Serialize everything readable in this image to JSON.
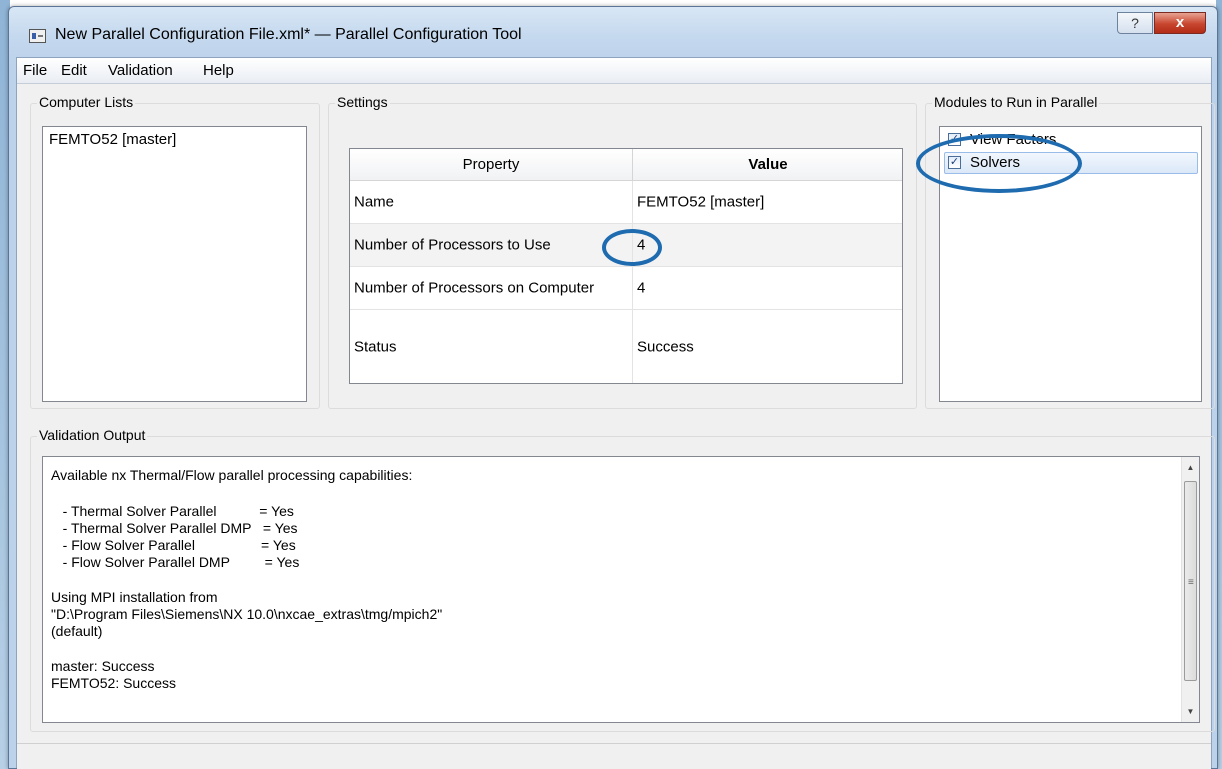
{
  "window": {
    "title": "New Parallel Configuration File.xml* — Parallel Configuration Tool",
    "help_glyph": "?",
    "close_glyph": "x"
  },
  "menu": [
    "File",
    "Edit",
    "Validation",
    "Help"
  ],
  "computer_lists": {
    "label": "Computer Lists",
    "items": [
      "FEMTO52 [master]"
    ]
  },
  "settings": {
    "label": "Settings",
    "columns": [
      "Property",
      "Value"
    ],
    "rows": [
      {
        "property": "Name",
        "value": "FEMTO52 [master]"
      },
      {
        "property": "Number of Processors to Use",
        "value": "4"
      },
      {
        "property": "Number of Processors on Computer",
        "value": "4"
      },
      {
        "property": "Status",
        "value": "Success"
      }
    ]
  },
  "modules": {
    "label": "Modules to Run in Parallel",
    "items": [
      {
        "label": "View Factors",
        "checked": true
      },
      {
        "label": "Solvers",
        "checked": true
      }
    ]
  },
  "validation": {
    "label": "Validation Output",
    "lines": [
      "Available nx Thermal/Flow parallel processing capabilities:",
      "",
      "   - Thermal Solver Parallel           = Yes",
      "   - Thermal Solver Parallel DMP   = Yes",
      "   - Flow Solver Parallel                 = Yes",
      "   - Flow Solver Parallel DMP         = Yes",
      "",
      "Using MPI installation from",
      "\"D:\\Program Files\\Siemens\\NX 10.0\\nxcae_extras\\tmg/mpich2\"",
      "(default)",
      "",
      "master: Success",
      "FEMTO52: Success"
    ]
  },
  "colors": {
    "annotation": "#1e6bb0",
    "title_gradient": "#c4d8ee",
    "close_button": "#c7452e"
  },
  "icons": {
    "app": "app-window-icon",
    "scroll_up": "scroll-up-arrow-icon",
    "scroll_down": "scroll-down-arrow-icon"
  }
}
